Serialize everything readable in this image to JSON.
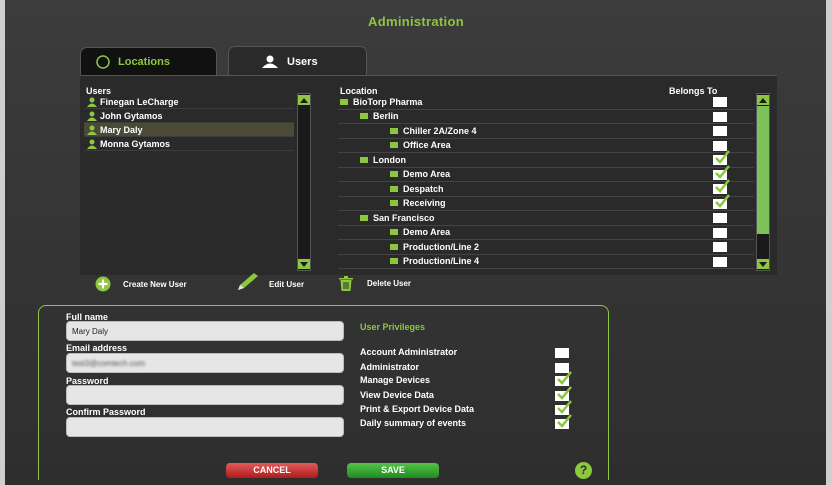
{
  "title": "Administration",
  "tabs": [
    {
      "label": "Locations",
      "icon": "compass-icon"
    },
    {
      "label": "Users",
      "icon": "person-icon"
    }
  ],
  "columns": {
    "users": "Users",
    "location": "Location",
    "belongs_to": "Belongs To"
  },
  "users": [
    "Finegan LeCharge",
    "John Gytamos",
    "Mary Daly",
    "Monna Gytamos"
  ],
  "selected_user": "Mary Daly",
  "locations": [
    {
      "name": "BioTorp Pharma",
      "level": 0,
      "checked": false
    },
    {
      "name": "Berlin",
      "level": 1,
      "checked": false
    },
    {
      "name": "Chiller 2A/Zone 4",
      "level": 2,
      "checked": false
    },
    {
      "name": "Office Area",
      "level": 2,
      "checked": false
    },
    {
      "name": "London",
      "level": 1,
      "checked": true
    },
    {
      "name": "Demo Area",
      "level": 2,
      "checked": true
    },
    {
      "name": "Despatch",
      "level": 2,
      "checked": true
    },
    {
      "name": "Receiving",
      "level": 2,
      "checked": true
    },
    {
      "name": "San Francisco",
      "level": 1,
      "checked": false
    },
    {
      "name": "Demo Area",
      "level": 2,
      "checked": false
    },
    {
      "name": "Production/Line 2",
      "level": 2,
      "checked": false
    },
    {
      "name": "Production/Line 4",
      "level": 2,
      "checked": false
    }
  ],
  "actions": {
    "create": "Create New User",
    "edit": "Edit User",
    "delete": "Delete User"
  },
  "form": {
    "full_name_label": "Full name",
    "full_name_value": "Mary Daly",
    "email_label": "Email address",
    "email_value": "test3@comtech.com",
    "password_label": "Password",
    "confirm_label": "Confirm Password"
  },
  "privileges": {
    "heading": "User Privileges",
    "items": [
      {
        "label": "Account Administrator",
        "checked": false
      },
      {
        "label": "Administrator",
        "checked": false
      },
      {
        "label": "Manage Devices",
        "checked": true
      },
      {
        "label": "View Device Data",
        "checked": true
      },
      {
        "label": "Print & Export Device Data",
        "checked": true
      },
      {
        "label": "Daily summary of events",
        "checked": true
      }
    ]
  },
  "buttons": {
    "cancel": "CANCEL",
    "save": "SAVE",
    "help": "?"
  },
  "colors": {
    "accent": "#8dc63f",
    "cancel": "#c62828",
    "save": "#2e9b2e"
  }
}
